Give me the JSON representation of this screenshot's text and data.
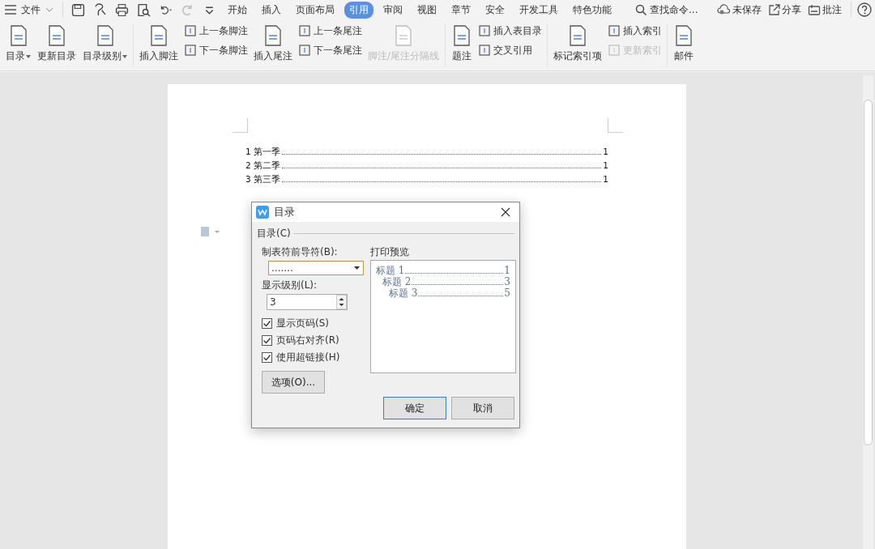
{
  "menu_bar": {
    "file_label": "文件",
    "tabs": [
      {
        "label": "开始",
        "selected": false
      },
      {
        "label": "插入",
        "selected": false
      },
      {
        "label": "页面布局",
        "selected": false
      },
      {
        "label": "引用",
        "selected": true
      },
      {
        "label": "审阅",
        "selected": false
      },
      {
        "label": "视图",
        "selected": false
      },
      {
        "label": "章节",
        "selected": false
      },
      {
        "label": "安全",
        "selected": false
      },
      {
        "label": "开发工具",
        "selected": false
      },
      {
        "label": "特色功能",
        "selected": false
      }
    ],
    "search_placeholder": "查找命令...",
    "save_status": "未保存",
    "share": "分享",
    "comment": "批注"
  },
  "ribbon": [
    {
      "items": [
        {
          "kind": "large",
          "label": "目录",
          "dropdown": true,
          "disabled": false
        },
        {
          "kind": "large",
          "label": "更新目录",
          "dropdown": false,
          "disabled": false
        },
        {
          "kind": "large",
          "label": "目录级别",
          "dropdown": true,
          "disabled": false
        }
      ]
    },
    {
      "items": [
        {
          "kind": "large",
          "label": "插入脚注",
          "dropdown": false,
          "disabled": false
        },
        {
          "kind": "stack",
          "items": [
            {
              "label": "上一条脚注",
              "disabled": false
            },
            {
              "label": "下一条脚注",
              "disabled": false
            }
          ]
        },
        {
          "kind": "large",
          "label": "插入尾注",
          "dropdown": false,
          "disabled": false
        },
        {
          "kind": "stack",
          "items": [
            {
              "label": "上一条尾注",
              "disabled": false
            },
            {
              "label": "下一条尾注",
              "disabled": false
            }
          ]
        },
        {
          "kind": "large",
          "label": "脚注/尾注分隔线",
          "dropdown": false,
          "disabled": true
        }
      ]
    },
    {
      "items": [
        {
          "kind": "large",
          "label": "题注",
          "dropdown": false,
          "disabled": false
        },
        {
          "kind": "stack",
          "items": [
            {
              "label": "插入表目录",
              "disabled": false
            },
            {
              "label": "交叉引用",
              "disabled": false
            }
          ]
        }
      ]
    },
    {
      "items": [
        {
          "kind": "large",
          "label": "标记索引项",
          "dropdown": false,
          "disabled": false
        },
        {
          "kind": "stack",
          "items": [
            {
              "label": "插入索引",
              "disabled": false
            },
            {
              "label": "更新索引",
              "disabled": true
            }
          ]
        }
      ]
    },
    {
      "items": [
        {
          "kind": "large",
          "label": "邮件",
          "dropdown": false,
          "disabled": false
        }
      ]
    }
  ],
  "document": {
    "toc": [
      {
        "number": "1",
        "title": "第一季",
        "page": "1"
      },
      {
        "number": "2",
        "title": "第二季",
        "page": "1"
      },
      {
        "number": "3",
        "title": "第三季",
        "page": "1"
      }
    ]
  },
  "dialog": {
    "title": "目录",
    "section": "目录(C)",
    "leader_label": "制表符前导符(B):",
    "leader_value": ".......",
    "level_label": "显示级别(L):",
    "level_value": "3",
    "checkboxes": [
      {
        "label": "显示页码(S)",
        "checked": true
      },
      {
        "label": "页码右对齐(R)",
        "checked": true
      },
      {
        "label": "使用超链接(H)",
        "checked": true
      }
    ],
    "options_button": "选项(O)...",
    "preview_label": "打印预览",
    "preview": [
      {
        "title": "标题 1",
        "page": "1",
        "children": [
          {
            "title": "标题 2",
            "page": "3",
            "children": [
              {
                "title": "标题 3",
                "page": "5"
              }
            ]
          }
        ]
      }
    ],
    "ok_button": "确定",
    "cancel_button": "取消"
  }
}
